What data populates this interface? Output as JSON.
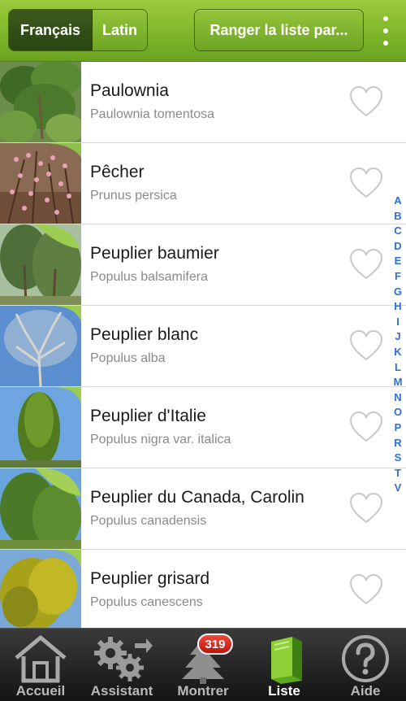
{
  "header": {
    "lang_tabs": [
      {
        "label": "Français",
        "active": true
      },
      {
        "label": "Latin",
        "active": false
      }
    ],
    "sort_button": "Ranger la liste par...",
    "overflow_icon": "vertical-dots-icon"
  },
  "list": {
    "items": [
      {
        "common": "Paulownia",
        "latin": "Paulownia tomentosa",
        "favorite": false
      },
      {
        "common": "Pêcher",
        "latin": "Prunus persica",
        "favorite": false
      },
      {
        "common": "Peuplier baumier",
        "latin": "Populus balsamifera",
        "favorite": false
      },
      {
        "common": "Peuplier blanc",
        "latin": "Populus alba",
        "favorite": false
      },
      {
        "common": "Peuplier d'Italie",
        "latin": "Populus nigra var. italica",
        "favorite": false
      },
      {
        "common": "Peuplier du Canada, Carolin",
        "latin": "Populus canadensis",
        "favorite": false
      },
      {
        "common": "Peuplier grisard",
        "latin": "Populus canescens",
        "favorite": false
      }
    ]
  },
  "alphabet": [
    "A",
    "B",
    "C",
    "D",
    "E",
    "F",
    "G",
    "H",
    "I",
    "J",
    "K",
    "L",
    "M",
    "N",
    "O",
    "P",
    "R",
    "S",
    "T",
    "V"
  ],
  "tabs": {
    "accueil": "Accueil",
    "assistant": "Assistant",
    "montrer": "Montrer",
    "liste": "Liste",
    "aide": "Aide",
    "selected": "Liste",
    "montrer_badge": "319"
  },
  "colors": {
    "header_green": "#7fb62a",
    "active_segment": "#2b4512",
    "index_blue": "#2d6fd6",
    "badge_red": "#d0241a",
    "tabbar_dark": "#1f1f1f"
  }
}
